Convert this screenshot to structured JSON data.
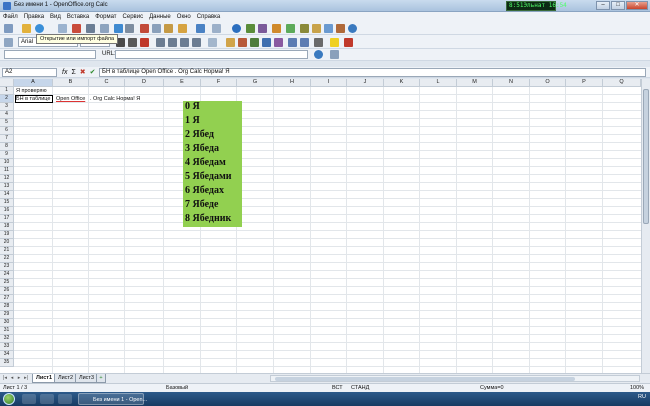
{
  "window": {
    "title": "Без имени 1 - OpenOffice.org Calc",
    "clock": "8:51Эльнат 16:54"
  },
  "menu": [
    "Файл",
    "Правка",
    "Вид",
    "Вставка",
    "Формат",
    "Сервис",
    "Данные",
    "Окно",
    "Справка"
  ],
  "tooltip": "Открытие или импорт файла",
  "toolbar": {
    "font_name": "Arial",
    "url_label": "URL:"
  },
  "formula_bar": {
    "name_box": "A2",
    "fx": "fx",
    "cancel": "✖",
    "accept": "✔",
    "content": "БН в таблице  Open Office . Org Calc Норма! Я"
  },
  "columns": [
    "A",
    "B",
    "C",
    "D",
    "E",
    "F",
    "G",
    "H",
    "I",
    "J",
    "K",
    "L",
    "M",
    "N",
    "O",
    "P",
    "Q"
  ],
  "rows": [
    "1",
    "2",
    "3",
    "4",
    "5",
    "6",
    "7",
    "8",
    "9",
    "10",
    "11",
    "12",
    "13",
    "14",
    "15",
    "16",
    "17",
    "18",
    "19",
    "20",
    "21",
    "22",
    "23",
    "24",
    "25",
    "26",
    "27",
    "28",
    "29",
    "30",
    "31",
    "32",
    "33",
    "34",
    "35"
  ],
  "cells": {
    "a1": "Я проверяю",
    "a2": "БН в таблице",
    "b2": "Open Office",
    "c2": ". Org Calc Норма! Я"
  },
  "green_block": [
    "0 Я",
    "1 Я",
    "2 Ябед",
    "3 Ябеда",
    "4 Ябедам",
    "5 Ябедами",
    "6 Ябедах",
    "7 Ябеде",
    "8 Ябедник"
  ],
  "sheet_tabs": [
    "Лист1",
    "Лист2",
    "Лист3"
  ],
  "status": {
    "sheet": "Лист 1 / 3",
    "style": "Базовый",
    "mode1": "ВСТ",
    "mode2": "СТАНД",
    "sum": "Сумма=0",
    "zoom": "100%"
  },
  "taskbar": {
    "item": "Без имени 1 - Open...",
    "tray": "RU"
  },
  "colors": {
    "green_fill": "#92d050"
  }
}
